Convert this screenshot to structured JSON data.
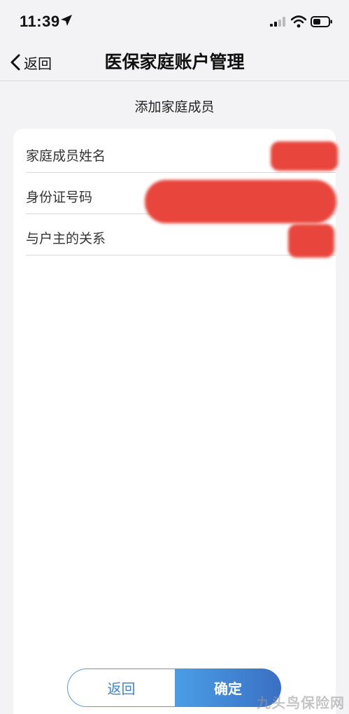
{
  "status_bar": {
    "time": "11:39"
  },
  "nav": {
    "back_label": "返回",
    "title": "医保家庭账户管理"
  },
  "section": {
    "subtitle": "添加家庭成员"
  },
  "form": {
    "fields": [
      {
        "label": "家庭成员姓名",
        "value": ""
      },
      {
        "label": "身份证号码",
        "value": ""
      },
      {
        "label": "与户主的关系",
        "value": ""
      }
    ]
  },
  "actions": {
    "back_label": "返回",
    "confirm_label": "确定"
  },
  "watermark": "九头鸟保险网",
  "colors": {
    "accent": "#3d86cf",
    "redaction": "#e8453c"
  }
}
